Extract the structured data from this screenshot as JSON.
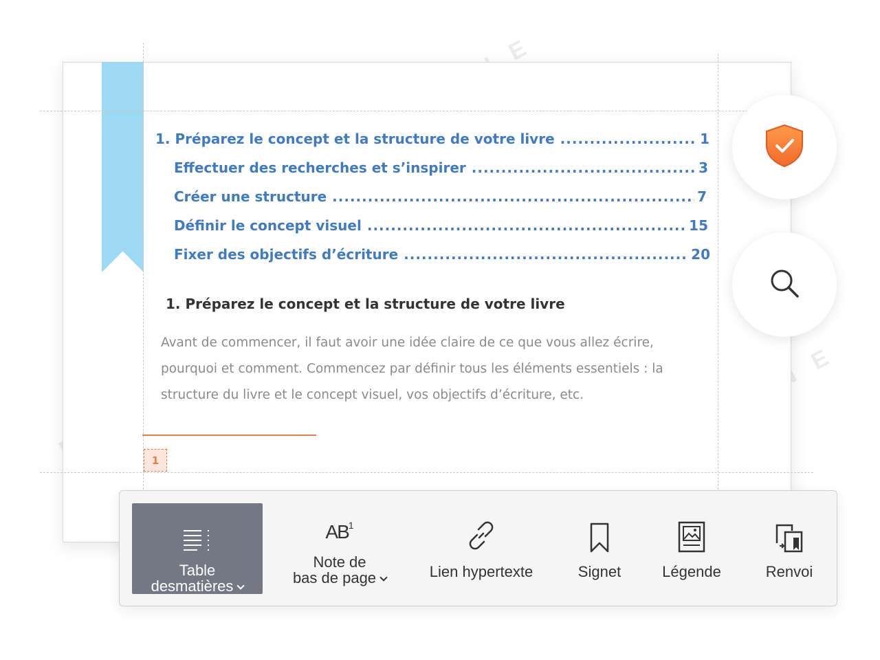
{
  "watermark": {
    "text": "FILIGRANE"
  },
  "toc": {
    "rows": [
      {
        "title": "1. Préparez le concept et la structure de votre livre",
        "page": "1"
      },
      {
        "title": "Effectuer des recherches et s’inspirer",
        "page": "3"
      },
      {
        "title": "Créer une structure",
        "page": "7"
      },
      {
        "title": "Définir le concept visuel",
        "page": "15"
      },
      {
        "title": "Fixer des objectifs d’écriture",
        "page": "20"
      }
    ],
    "color": "#3f7bc4"
  },
  "section": {
    "heading": "1. Préparez le concept et la structure de votre livre",
    "paragraph_lines": [
      "Avant de commencer, il faut avoir une idée claire de ce que vous allez écrire,",
      "pourquoi et comment. Commencez par définir tous les éléments essentiels : la",
      "structure du livre et le concept visuel, vos objectifs d’écriture, etc."
    ]
  },
  "footnote": {
    "number": "1",
    "accent": "#f07a4a"
  },
  "side_buttons": {
    "shield_icon": "shield-check-icon",
    "search_icon": "magnifier-icon"
  },
  "toolbar": {
    "toc": {
      "line1": "Table",
      "line2": "desmatières",
      "icon": "table-of-contents-icon"
    },
    "footnote": {
      "line1": "Note de",
      "line2": "bas de page",
      "icon": "footnote-icon",
      "icon_text": "AB",
      "icon_sup": "1"
    },
    "hyperlink": {
      "label": "Lien hypertexte",
      "icon": "link-icon"
    },
    "bookmark": {
      "label": "Signet",
      "icon": "bookmark-icon"
    },
    "caption": {
      "label": "Légende",
      "icon": "image-caption-icon"
    },
    "crossref": {
      "label": "Renvoi",
      "icon": "cross-reference-icon"
    },
    "active_bg": "#747884"
  }
}
